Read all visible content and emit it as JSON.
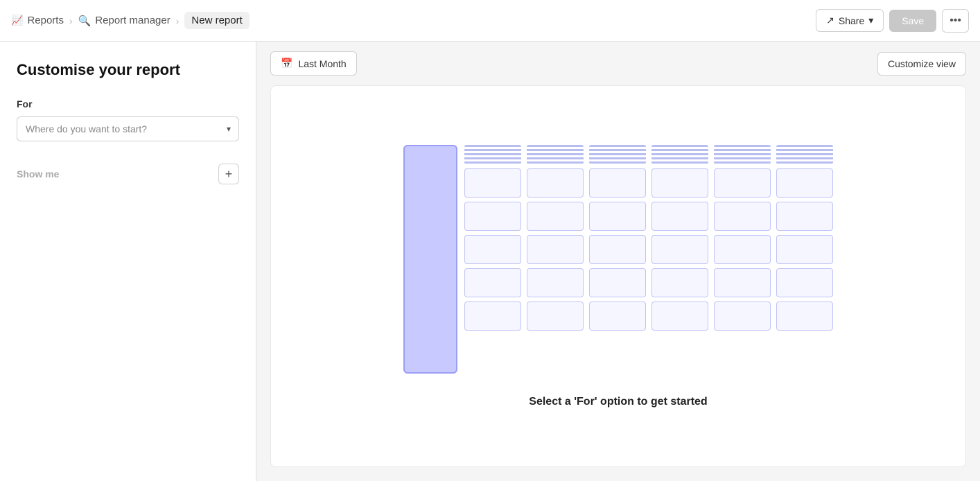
{
  "header": {
    "reports_label": "Reports",
    "report_manager_label": "Report manager",
    "new_report_label": "New report",
    "share_label": "Share",
    "save_label": "Save",
    "more_icon": "⋯"
  },
  "sidebar": {
    "title": "Customise your report",
    "for_label": "For",
    "for_placeholder": "Where do you want to start?",
    "show_me_label": "Show me",
    "add_icon": "+"
  },
  "toolbar": {
    "date_label": "Last Month",
    "customize_label": "Customize view"
  },
  "preview": {
    "empty_text": "Select a 'For' option to get started"
  }
}
